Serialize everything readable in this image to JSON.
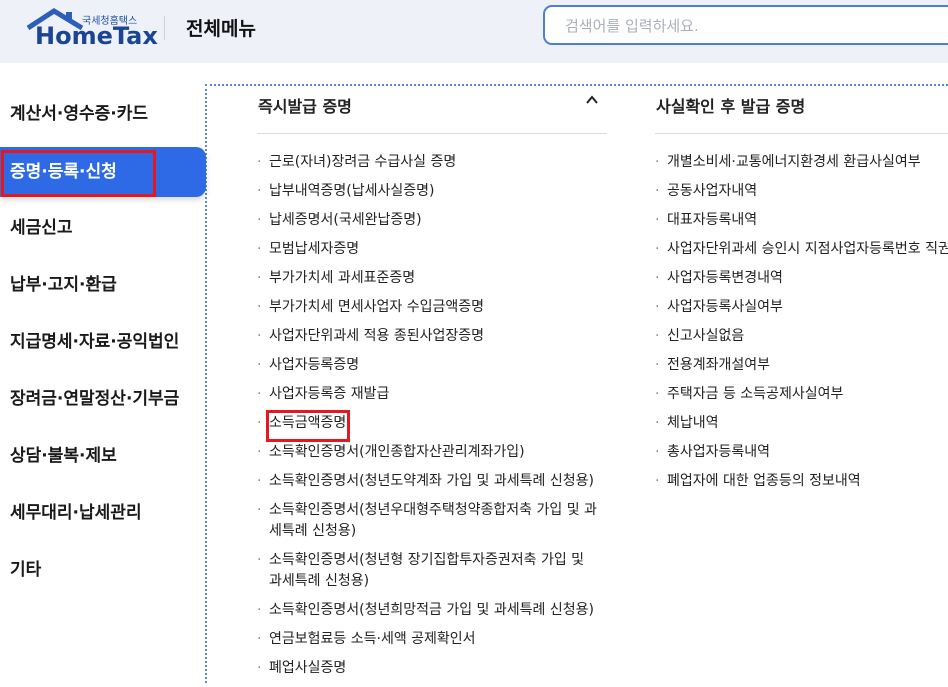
{
  "header": {
    "logo_small": "국세청홈택스",
    "logo_big": "HomeTax",
    "title": "전체메뉴",
    "search_placeholder": "검색어를 입력하세요."
  },
  "nav": {
    "items": [
      {
        "label": "계산서·영수증·카드",
        "active": false
      },
      {
        "label": "증명·등록·신청",
        "active": true
      },
      {
        "label": "세금신고",
        "active": false
      },
      {
        "label": "납부·고지·환급",
        "active": false
      },
      {
        "label": "지급명세·자료·공익법인",
        "active": false
      },
      {
        "label": "장려금·연말정산·기부금",
        "active": false
      },
      {
        "label": "상담·불복·제보",
        "active": false
      },
      {
        "label": "세무대리·납세관리",
        "active": false
      },
      {
        "label": "기타",
        "active": false
      }
    ]
  },
  "left_column": {
    "heading": "즉시발급 증명",
    "items": [
      "근로(자녀)장려금 수급사실 증명",
      "납부내역증명(납세사실증명)",
      "납세증명서(국세완납증명)",
      "모범납세자증명",
      "부가가치세 과세표준증명",
      "부가가치세 면세사업자 수입금액증명",
      "사업자단위과세 적용 종된사업장증명",
      "사업자등록증명",
      "사업자등록증 재발급",
      "소득금액증명",
      "소득확인증명서(개인종합자산관리계좌가입)",
      "소득확인증명서(청년도약계좌 가입 및 과세특례 신청용)",
      "소득확인증명서(청년우대형주택청약종합저축 가입 및 과세특례 신청용)",
      "소득확인증명서(청년형 장기집합투자증권저축 가입 및 과세특례 신청용)",
      "소득확인증명서(청년희망적금 가입 및 과세특례 신청용)",
      "연금보험료등 소득·세액 공제확인서",
      "폐업사실증명"
    ]
  },
  "right_column": {
    "heading": "사실확인 후 발급 증명",
    "items": [
      "개별소비세·교통에너지환경세 환급사실여부",
      "공동사업자내역",
      "대표자등록내역",
      "사업자단위과세 승인시 지점사업자등록번호 직권",
      "사업자등록변경내역",
      "사업자등록사실여부",
      "신고사실없음",
      "전용계좌개설여부",
      "주택자금 등 소득공제사실여부",
      "체납내역",
      "총사업자등록내역",
      "폐업자에 대한 업종등의 정보내역"
    ]
  },
  "colors": {
    "accent": "#2e6ae6",
    "highlight_box": "#e4181f",
    "header_bg": "#eef1f8"
  }
}
